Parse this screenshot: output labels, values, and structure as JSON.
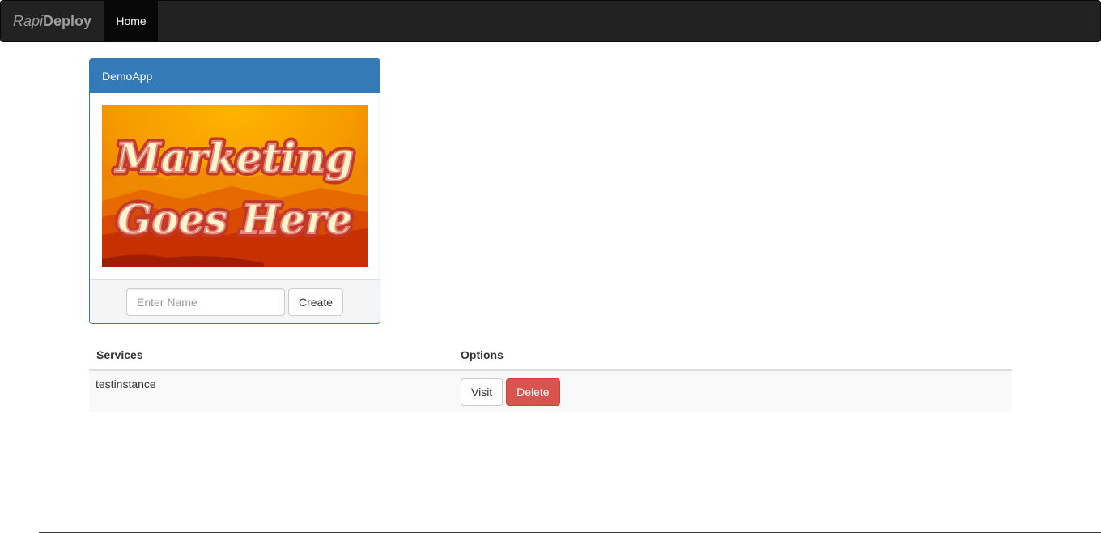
{
  "navbar": {
    "brand_part1": "Rapi",
    "brand_part2": "Deploy",
    "home_label": "Home"
  },
  "app_panel": {
    "title": "DemoApp",
    "image": {
      "line1": "Marketing",
      "line2": "Goes Here"
    },
    "name_placeholder": "Enter Name",
    "name_value": "",
    "create_label": "Create"
  },
  "services_table": {
    "headers": [
      "Services",
      "Options"
    ],
    "rows": [
      {
        "service": "testinstance",
        "visit_label": "Visit",
        "delete_label": "Delete"
      }
    ]
  },
  "colors": {
    "navbar_bg": "#222222",
    "panel_primary": "#337ab7",
    "danger": "#d9534f"
  }
}
